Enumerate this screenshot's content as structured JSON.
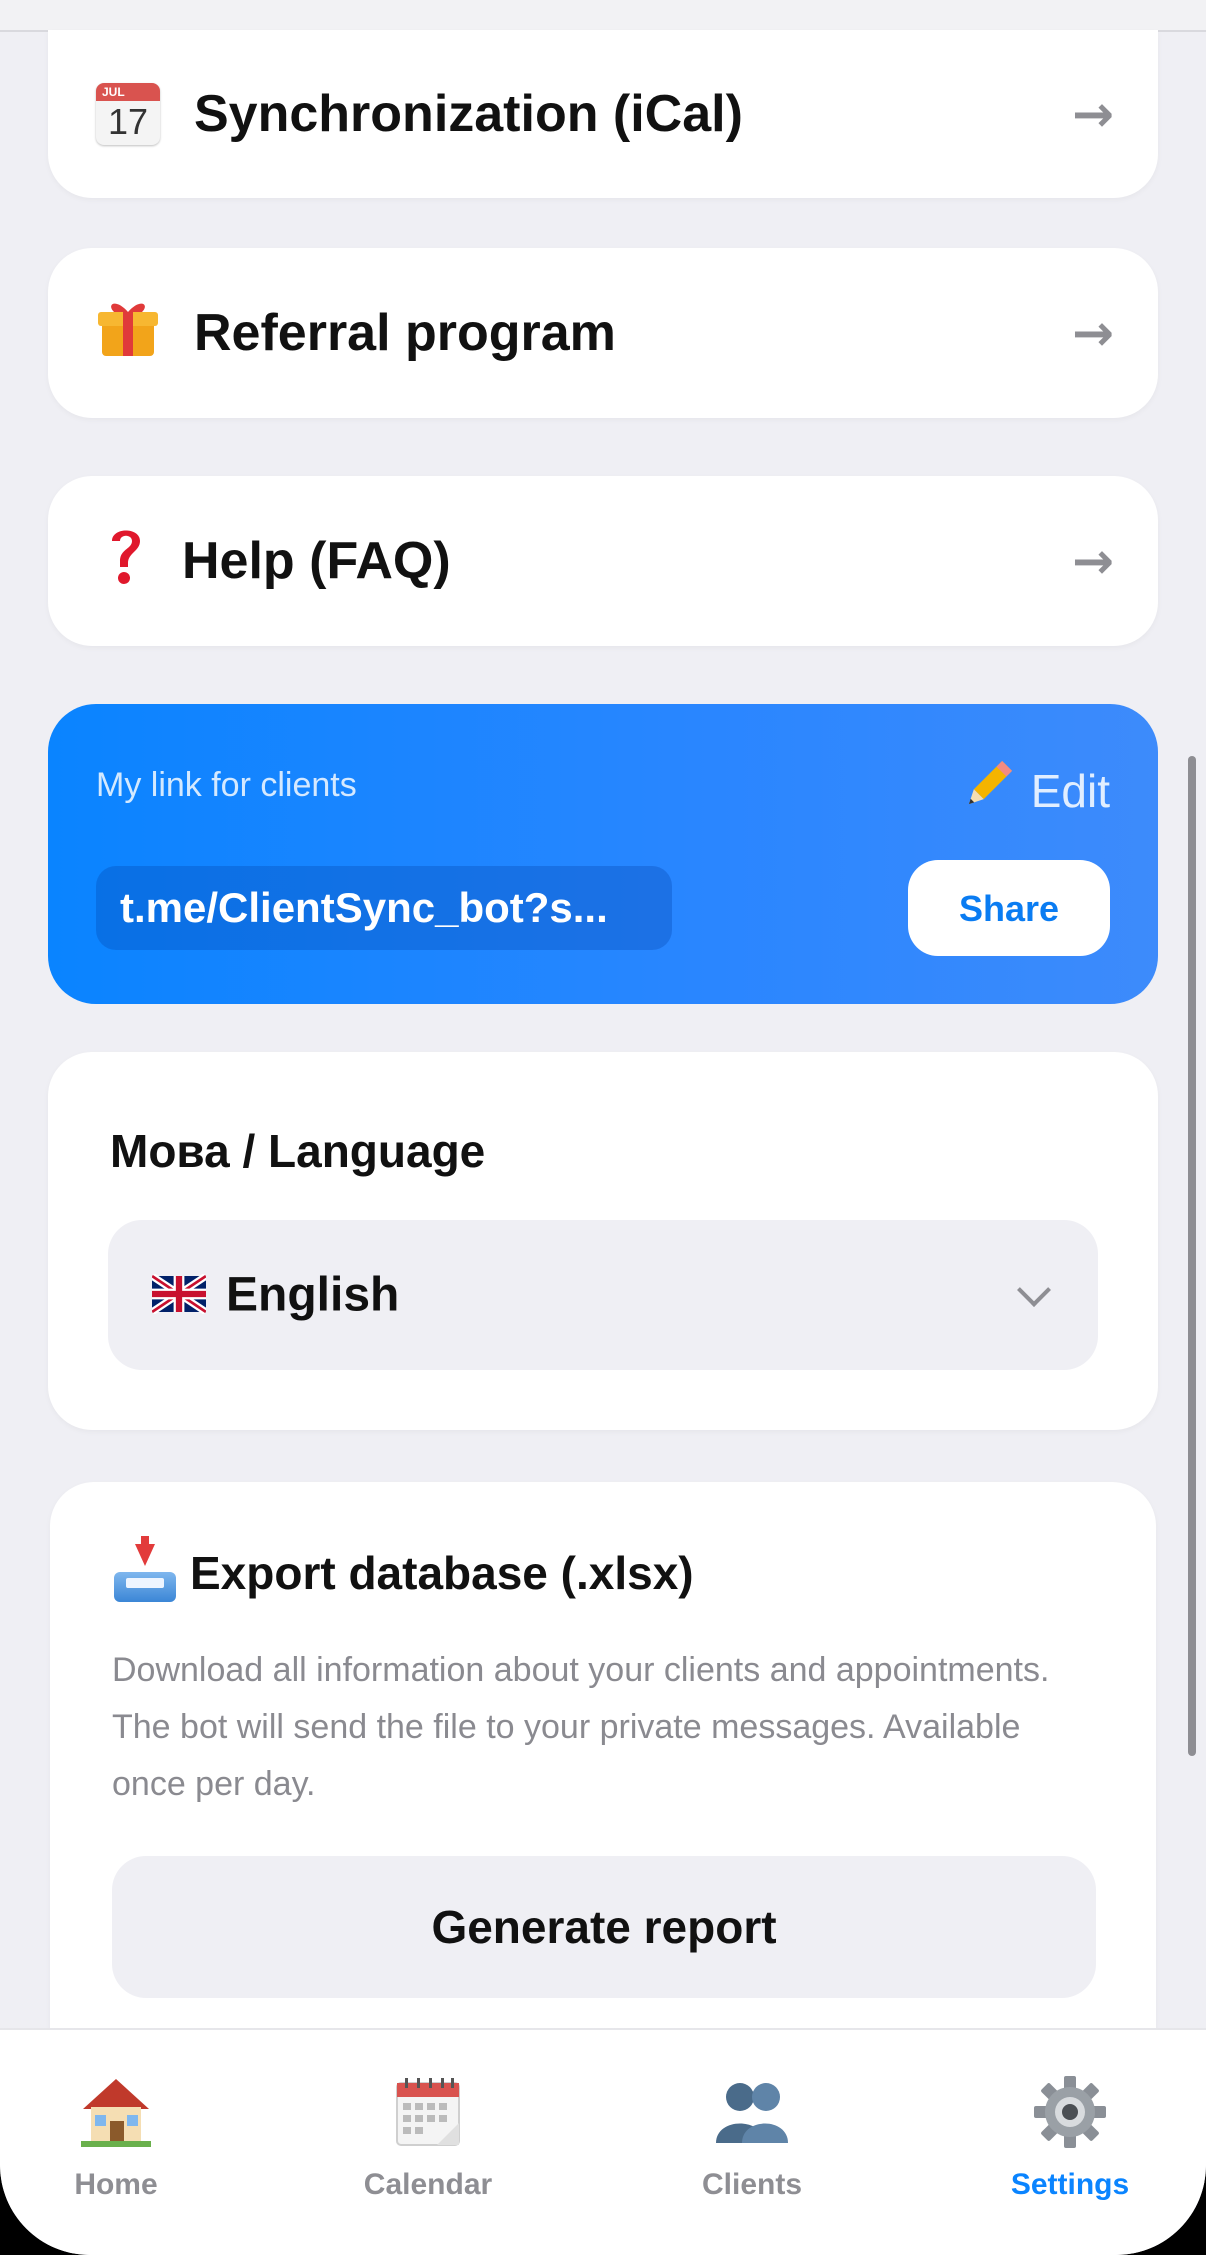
{
  "menu": [
    {
      "label": "Synchronization (iCal)",
      "icon": "calendar-icon",
      "calendar_month": "JUL",
      "calendar_day": "17"
    },
    {
      "label": "Referral program",
      "icon": "gift-icon"
    },
    {
      "label": "Help (FAQ)",
      "icon": "question-mark-icon"
    }
  ],
  "arrow_glyph": "→",
  "link_card": {
    "title": "My link for clients",
    "edit_label": "Edit",
    "link_value": "t.me/ClientSync_bot?s...",
    "share_label": "Share"
  },
  "language": {
    "heading": "Мова / Language",
    "selected": "English",
    "flag": "uk-flag-icon"
  },
  "export": {
    "heading": "Export database (.xlsx)",
    "description": "Download all information about your clients and appointments. The bot will send the file to your private messages. Available once per day.",
    "button_label": "Generate report"
  },
  "tabs": [
    {
      "label": "Home",
      "icon": "house-icon",
      "active": false
    },
    {
      "label": "Calendar",
      "icon": "calendar-icon",
      "active": false
    },
    {
      "label": "Clients",
      "icon": "users-icon",
      "active": false
    },
    {
      "label": "Settings",
      "icon": "gear-icon",
      "active": true
    }
  ],
  "colors": {
    "accent": "#0a84ff",
    "background": "#efeff4",
    "card": "#ffffff",
    "muted_text": "#8e8e93"
  }
}
